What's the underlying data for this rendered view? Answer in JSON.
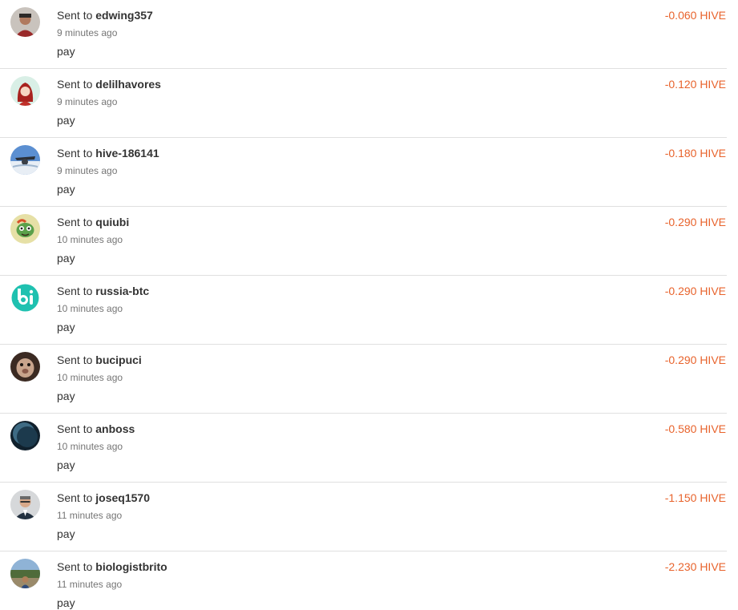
{
  "transactions": [
    {
      "prefix": "Sent to",
      "user": "edwing357",
      "time": "9 minutes ago",
      "memo": "pay",
      "amount": "-0.060 HIVE",
      "avatar_icon": "user-avatar-icon"
    },
    {
      "prefix": "Sent to",
      "user": "delilhavores",
      "time": "9 minutes ago",
      "memo": "pay",
      "amount": "-0.120 HIVE",
      "avatar_icon": "user-avatar-icon"
    },
    {
      "prefix": "Sent to",
      "user": "hive-186141",
      "time": "9 minutes ago",
      "memo": "pay",
      "amount": "-0.180 HIVE",
      "avatar_icon": "user-avatar-icon"
    },
    {
      "prefix": "Sent to",
      "user": "quiubi",
      "time": "10 minutes ago",
      "memo": "pay",
      "amount": "-0.290 HIVE",
      "avatar_icon": "user-avatar-icon"
    },
    {
      "prefix": "Sent to",
      "user": "russia-btc",
      "time": "10 minutes ago",
      "memo": "pay",
      "amount": "-0.290 HIVE",
      "avatar_icon": "user-avatar-icon"
    },
    {
      "prefix": "Sent to",
      "user": "bucipuci",
      "time": "10 minutes ago",
      "memo": "pay",
      "amount": "-0.290 HIVE",
      "avatar_icon": "user-avatar-icon"
    },
    {
      "prefix": "Sent to",
      "user": "anboss",
      "time": "10 minutes ago",
      "memo": "pay",
      "amount": "-0.580 HIVE",
      "avatar_icon": "user-avatar-icon"
    },
    {
      "prefix": "Sent to",
      "user": "joseq1570",
      "time": "11 minutes ago",
      "memo": "pay",
      "amount": "-1.150 HIVE",
      "avatar_icon": "user-avatar-icon"
    },
    {
      "prefix": "Sent to",
      "user": "biologistbrito",
      "time": "11 minutes ago",
      "memo": "pay",
      "amount": "-2.230 HIVE",
      "avatar_icon": "user-avatar-icon"
    }
  ],
  "colors": {
    "amount": "#e8632c",
    "text": "#333333",
    "muted": "#757575",
    "divider": "#e0e0e0"
  }
}
